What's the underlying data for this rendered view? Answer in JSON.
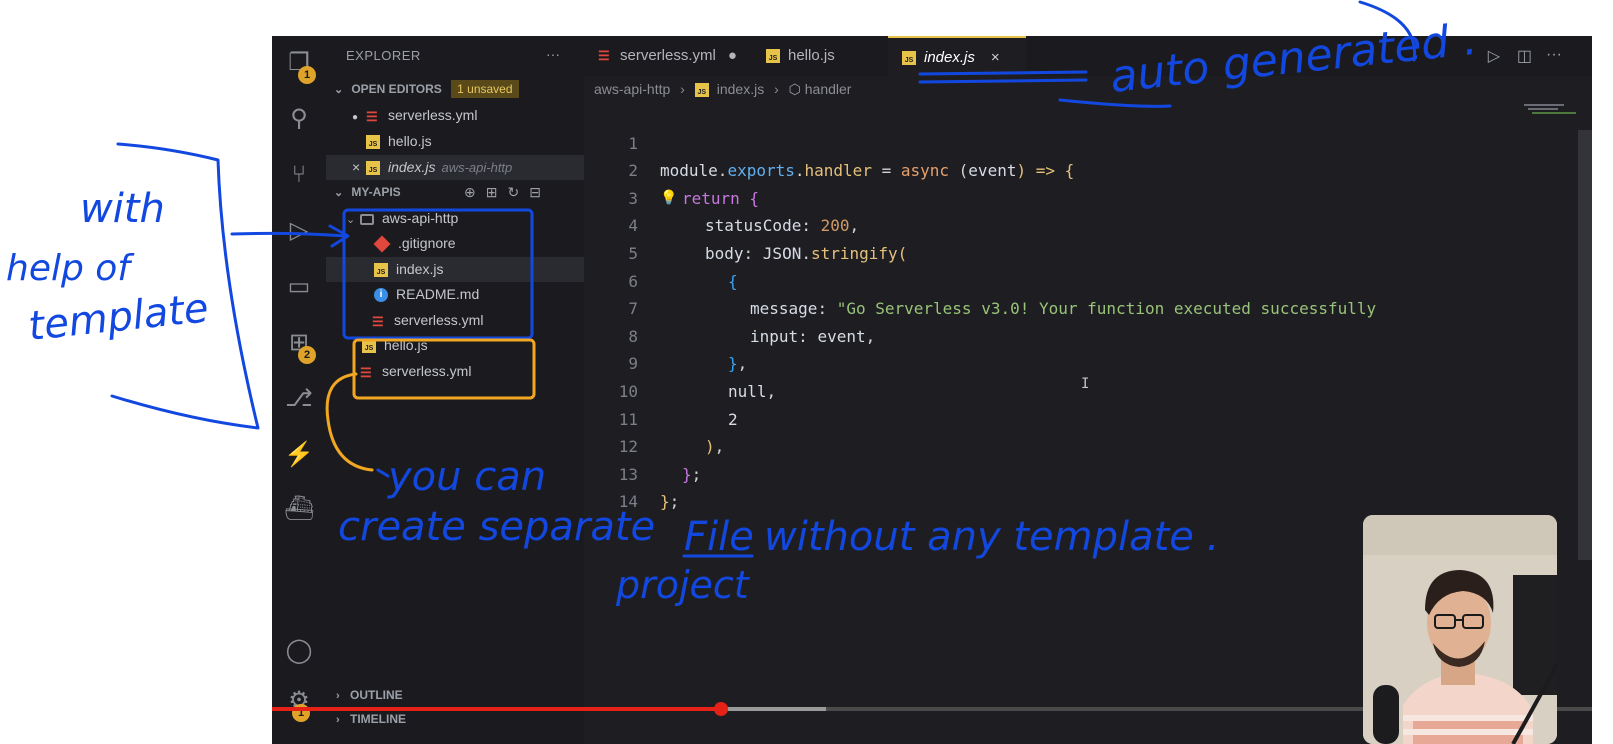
{
  "activity_bar": {
    "explorer_badge": "1",
    "extensions_badge": "2",
    "settings_badge": "1"
  },
  "sidebar": {
    "title": "EXPLORER",
    "more": "···",
    "open_editors": {
      "label": "OPEN EDITORS",
      "badge": "1 unsaved",
      "items": [
        {
          "name": "serverless.yml",
          "prefix": "●",
          "path": ""
        },
        {
          "name": "hello.js",
          "prefix": "",
          "path": ""
        },
        {
          "name": "index.js",
          "prefix": "×",
          "path": "aws-api-http"
        }
      ]
    },
    "workspace": {
      "label": "MY-APIS",
      "folder": "aws-api-http",
      "folder_items": [
        ".gitignore",
        "index.js",
        "README.md",
        "serverless.yml"
      ],
      "root_items": [
        "hello.js",
        "serverless.yml"
      ]
    },
    "outline": "OUTLINE",
    "timeline": "TIMELINE"
  },
  "tabs": [
    {
      "label": "serverless.yml",
      "modified": "●"
    },
    {
      "label": "hello.js"
    },
    {
      "label": "index.js",
      "close": "×"
    }
  ],
  "breadcrumb": {
    "folder": "aws-api-http",
    "file": "index.js",
    "symbol": "handler"
  },
  "editor": {
    "lines": [
      "1",
      "2",
      "3",
      "4",
      "5",
      "6",
      "7",
      "8",
      "9",
      "10",
      "11",
      "12",
      "13",
      "14"
    ],
    "code": {
      "l1_a": "module",
      "l1_b": ".",
      "l1_c": "exports",
      "l1_d": ".",
      "l1_e": "handler",
      "l1_f": " = ",
      "l1_g": "async",
      "l1_h": " (",
      "l1_i": "event",
      "l1_j": ") => ",
      "l1_k": "{",
      "l2_a": "return",
      "l2_b": " {",
      "l3_a": "statusCode",
      "l3_b": ": ",
      "l3_c": "200",
      "l3_d": ",",
      "l4_a": "body",
      "l4_b": ": ",
      "l4_c": "JSON",
      "l4_d": ".",
      "l4_e": "stringify",
      "l4_f": "(",
      "l5_a": "{",
      "l6_a": "message",
      "l6_b": ": ",
      "l6_c": "\"Go Serverless v3.0! Your function executed successfully",
      "l7_a": "input",
      "l7_b": ": ",
      "l7_c": "event",
      "l7_d": ",",
      "l8_a": "}",
      "l8_b": ",",
      "l9_a": "null",
      "l9_b": ",",
      "l10_a": "2",
      "l11_a": ")",
      "l11_b": ",",
      "l12_a": "}",
      "l12_b": ";",
      "l13_a": "}",
      "l13_b": ";"
    }
  },
  "annotations": {
    "with_template": [
      "with",
      "help of",
      "template"
    ],
    "auto_generated": "auto generated .",
    "you_can": "you can",
    "create_separate": "create separate",
    "file": "File",
    "without_template": "without any template .",
    "project": "project"
  },
  "video": {
    "played_fraction": 0.34,
    "buffered_fraction": 0.42
  },
  "colors": {
    "ink": "#1248e0",
    "orange_box": "#f2a722",
    "accent": "#e8c34a"
  }
}
